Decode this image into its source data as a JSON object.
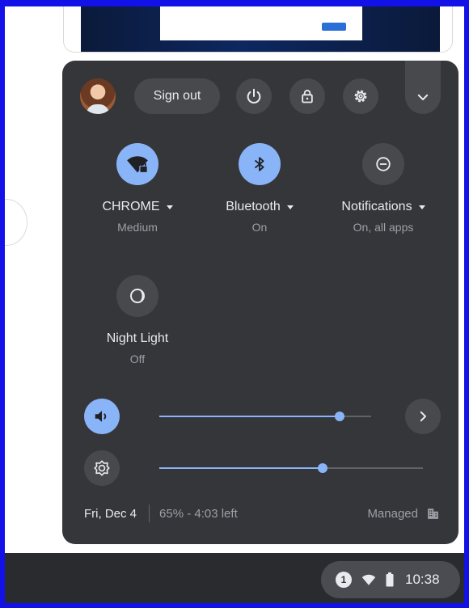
{
  "header": {
    "sign_out_label": "Sign out"
  },
  "tiles": [
    {
      "label": "CHROME",
      "sublabel": "Medium",
      "icon": "wifi-icon",
      "active": true
    },
    {
      "label": "Bluetooth",
      "sublabel": "On",
      "icon": "bluetooth-icon",
      "active": true
    },
    {
      "label": "Notifications",
      "sublabel": "On, all apps",
      "icon": "notifications-icon",
      "active": false
    },
    {
      "label": "Night Light",
      "sublabel": "Off",
      "icon": "night-light-icon",
      "active": false
    }
  ],
  "sliders": {
    "volume_level": 0.85,
    "brightness_level": 0.62
  },
  "footer": {
    "date": "Fri, Dec 4",
    "battery": "65% - 4:03 left",
    "managed": "Managed"
  },
  "shelf": {
    "notification_count": "1",
    "time": "10:38"
  },
  "colors": {
    "panel_bg": "#353639",
    "accent": "#8ab4f8",
    "shelf_bg": "#2a2b2e",
    "frame": "#1212e8"
  }
}
